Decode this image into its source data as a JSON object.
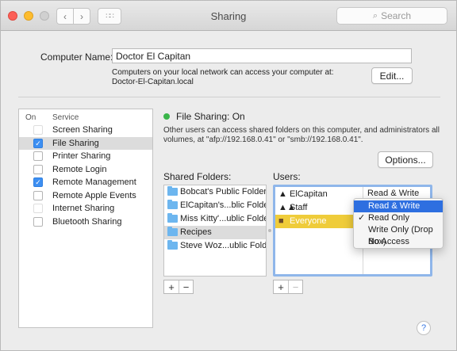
{
  "window": {
    "title": "Sharing",
    "search_placeholder": "Search",
    "traffic_colors": {
      "close": "#fc5f57",
      "minimize": "#fdbc2e",
      "zoom": "#d0d0d0"
    }
  },
  "computer": {
    "label": "Computer Name:",
    "name": "Doctor El Capitan",
    "desc_line1": "Computers on your local network can access your computer at:",
    "desc_line2": "Doctor-El-Capitan.local",
    "edit_label": "Edit..."
  },
  "services": {
    "header_on": "On",
    "header_service": "Service",
    "items": [
      {
        "label": "Screen Sharing",
        "checked": false,
        "disabled": true
      },
      {
        "label": "File Sharing",
        "checked": true,
        "selected": true
      },
      {
        "label": "Printer Sharing",
        "checked": false
      },
      {
        "label": "Remote Login",
        "checked": false
      },
      {
        "label": "Remote Management",
        "checked": true
      },
      {
        "label": "Remote Apple Events",
        "checked": false
      },
      {
        "label": "Internet Sharing",
        "checked": false,
        "disabled": true
      },
      {
        "label": "Bluetooth Sharing",
        "checked": false
      }
    ]
  },
  "file_sharing": {
    "status": "File Sharing: On",
    "status_color": "#3ab54a",
    "desc": "Other users can access shared folders on this computer, and administrators all volumes, at \"afp://192.168.0.41\" or \"smb://192.168.0.41\".",
    "options_label": "Options...",
    "shared_folders_label": "Shared Folders:",
    "users_label": "Users:",
    "folders": [
      {
        "label": "Bobcat's Public Folder"
      },
      {
        "label": "ElCapitan's...blic Folder"
      },
      {
        "label": "Miss Kitty'...ublic Folder"
      },
      {
        "label": "Recipes",
        "selected": true
      },
      {
        "label": "Steve Woz...ublic Folder"
      }
    ],
    "users": [
      {
        "name": "ElCapitan",
        "icon": "user-icon",
        "permission": "Read & Write"
      },
      {
        "name": "Staff",
        "icon": "group-icon"
      },
      {
        "name": "Everyone",
        "icon": "everyone-icon",
        "selected": true
      }
    ],
    "perm_chevron": "⌃⌄",
    "add": "+",
    "remove": "−"
  },
  "permission_menu": {
    "items": [
      {
        "label": "Read & Write",
        "highlighted": true
      },
      {
        "label": "Read Only",
        "checked": true
      },
      {
        "label": "Write Only (Drop Box)"
      },
      {
        "label": "No Access"
      }
    ],
    "check_glyph": "✓",
    "highlight_color": "#2e6fe0"
  },
  "help": "?"
}
